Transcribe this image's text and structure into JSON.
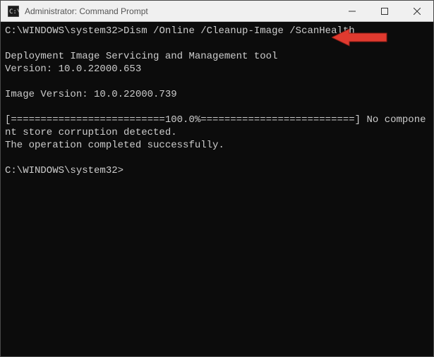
{
  "window": {
    "title": "Administrator: Command Prompt"
  },
  "terminal": {
    "prompt1": "C:\\WINDOWS\\system32>",
    "command1": "Dism /Online /Cleanup-Image /ScanHealth",
    "blank": "",
    "line_tool": "Deployment Image Servicing and Management tool",
    "line_version": "Version: 10.0.22000.653",
    "line_imgver": "Image Version: 10.0.22000.739",
    "progress": "[==========================100.0%==========================] No component store corruption detected.",
    "line_done": "The operation completed successfully.",
    "prompt2": "C:\\WINDOWS\\system32>"
  },
  "annotation": {
    "arrow_color": "#e03a2f"
  }
}
